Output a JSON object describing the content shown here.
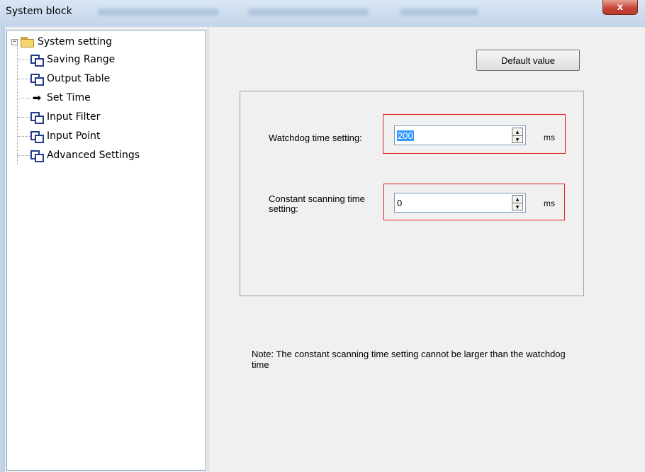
{
  "window": {
    "title": "System block",
    "close_label": "x"
  },
  "tree": {
    "root_label": "System setting",
    "expander_symbol": "−",
    "items": [
      {
        "label": "Saving Range",
        "icon": "window-icon"
      },
      {
        "label": "Output Table",
        "icon": "window-icon"
      },
      {
        "label": "Set Time",
        "icon": "arrow-right-icon",
        "selected": true
      },
      {
        "label": "Input Filter",
        "icon": "window-icon"
      },
      {
        "label": "Input Point",
        "icon": "window-icon"
      },
      {
        "label": "Advanced Settings",
        "icon": "window-icon"
      }
    ]
  },
  "main": {
    "default_button": "Default value",
    "watchdog": {
      "label": "Watchdog time setting:",
      "value": "200",
      "unit": "ms"
    },
    "constant_scan": {
      "label": "Constant scanning time setting:",
      "value": "0",
      "unit": "ms"
    },
    "note": "Note: The constant scanning time setting cannot be larger than the watchdog time"
  },
  "colors": {
    "highlight_border": "#e02020",
    "selection": "#3399ff"
  }
}
